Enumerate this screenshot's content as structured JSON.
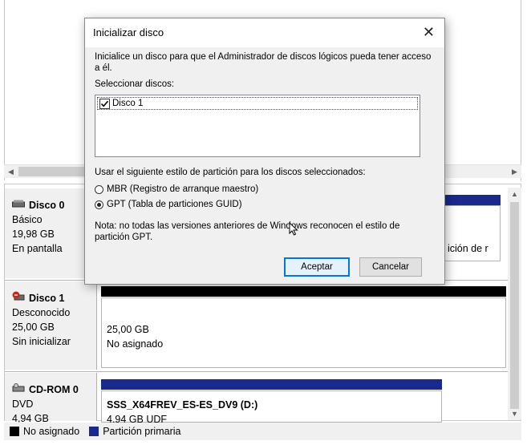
{
  "background": {
    "disk0": {
      "name": "Disco 0",
      "type": "Básico",
      "size": "19,98 GB",
      "status": "En pantalla",
      "partition_fragment": "ición de r"
    },
    "disk1": {
      "name": "Disco 1",
      "type": "Desconocido",
      "size": "25,00 GB",
      "status": "Sin inicializar",
      "volume_size": "25,00 GB",
      "volume_state": "No asignado"
    },
    "cdrom0": {
      "name": "CD-ROM 0",
      "type": "DVD",
      "size": "4,94 GB",
      "volume_label": "SSS_X64FREV_ES-ES_DV9  (D:)",
      "volume_fs": "4,94 GB UDF"
    },
    "legend": {
      "unallocated": "No asignado",
      "primary": "Partición primaria"
    },
    "colors": {
      "unallocated": "#000000",
      "primary": "#1a2a8c"
    }
  },
  "dialog": {
    "title": "Inicializar disco",
    "instruction": "Inicialice un disco para que el Administrador de discos lógicos pueda tener acceso a él.",
    "select_label": "Seleccionar discos:",
    "disks": [
      {
        "label": "Disco 1",
        "checked": true
      }
    ],
    "partition_style_label": "Usar el siguiente estilo de partición para los discos seleccionados:",
    "option_mbr": "MBR (Registro de arranque maestro)",
    "option_gpt": "GPT (Tabla de particiones GUID)",
    "selected_option": "GPT",
    "note": "Nota: no todas las versiones anteriores de Windows reconocen el estilo de partición GPT.",
    "ok_label": "Aceptar",
    "cancel_label": "Cancelar"
  }
}
